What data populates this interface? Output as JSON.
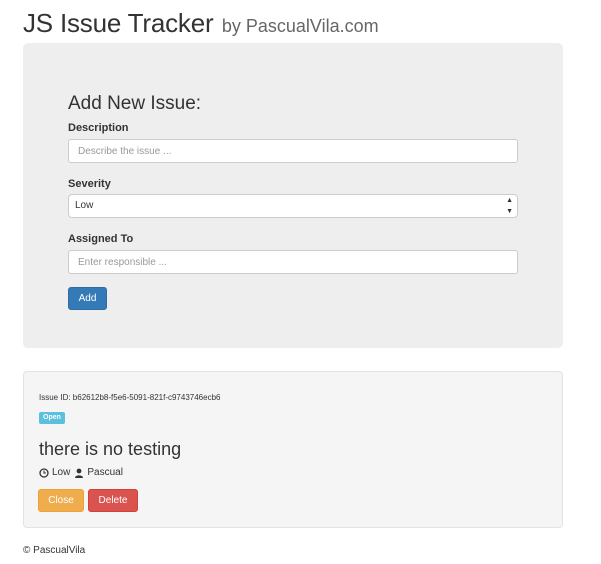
{
  "header": {
    "title": "JS Issue Tracker",
    "subtitle": "by PascualVila.com"
  },
  "form": {
    "heading": "Add New Issue:",
    "description_label": "Description",
    "description_placeholder": "Describe the issue ...",
    "description_value": "",
    "severity_label": "Severity",
    "severity_value": "Low",
    "assigned_label": "Assigned To",
    "assigned_placeholder": "Enter responsible ...",
    "assigned_value": "",
    "add_label": "Add"
  },
  "issue": {
    "id_text": "Issue ID: b62612b8-f5e6-5091-821f-c9743746ecb6",
    "status": "Open",
    "description": "there is no testing",
    "severity": "Low",
    "assigned_to": "Pascual",
    "close_label": "Close",
    "delete_label": "Delete"
  },
  "footer": {
    "text": "© PascualVila"
  },
  "colors": {
    "primary": "#337ab7",
    "warning": "#f0ad4e",
    "danger": "#d9534f",
    "info": "#5bc0de"
  },
  "icons": {
    "severity": "clock-icon",
    "assignee": "user-icon",
    "select": "updown-arrows-icon"
  }
}
